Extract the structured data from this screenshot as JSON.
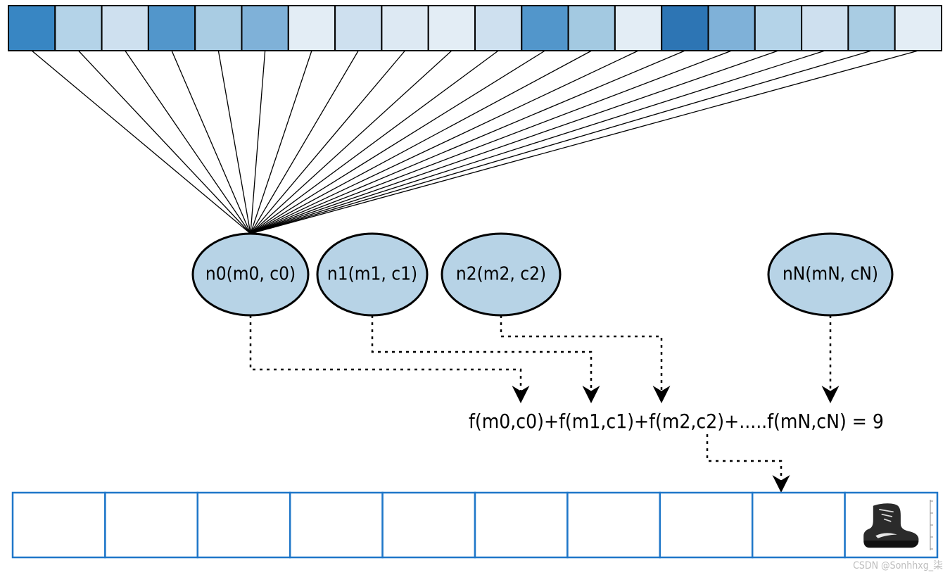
{
  "input_cells": {
    "count": 20,
    "colors": [
      "#3886c3",
      "#b4d3e8",
      "#cee0ef",
      "#5296cb",
      "#a9cce3",
      "#7fb1d8",
      "#e3edf5",
      "#cee0ef",
      "#dde9f3",
      "#e3edf5",
      "#cee0ef",
      "#5296cb",
      "#a3c9e1",
      "#e3edf5",
      "#2d75b4",
      "#7fb1d8",
      "#b4d3e8",
      "#cee0ef",
      "#a9cce3",
      "#e3edf5"
    ]
  },
  "nodes": {
    "n0": "n0(m0, c0)",
    "n1": "n1(m1, c1)",
    "n2": "n2(m2, c2)",
    "nN": "nN(mN, cN)"
  },
  "formula": "f(m0,c0)+f(m1,c1)+f(m2,c2)+.....f(mN,cN) = 9",
  "output": {
    "count": 10,
    "result_index": 9,
    "result_icon": "boot"
  },
  "watermark": "CSDN @Sonhhxg_柒"
}
